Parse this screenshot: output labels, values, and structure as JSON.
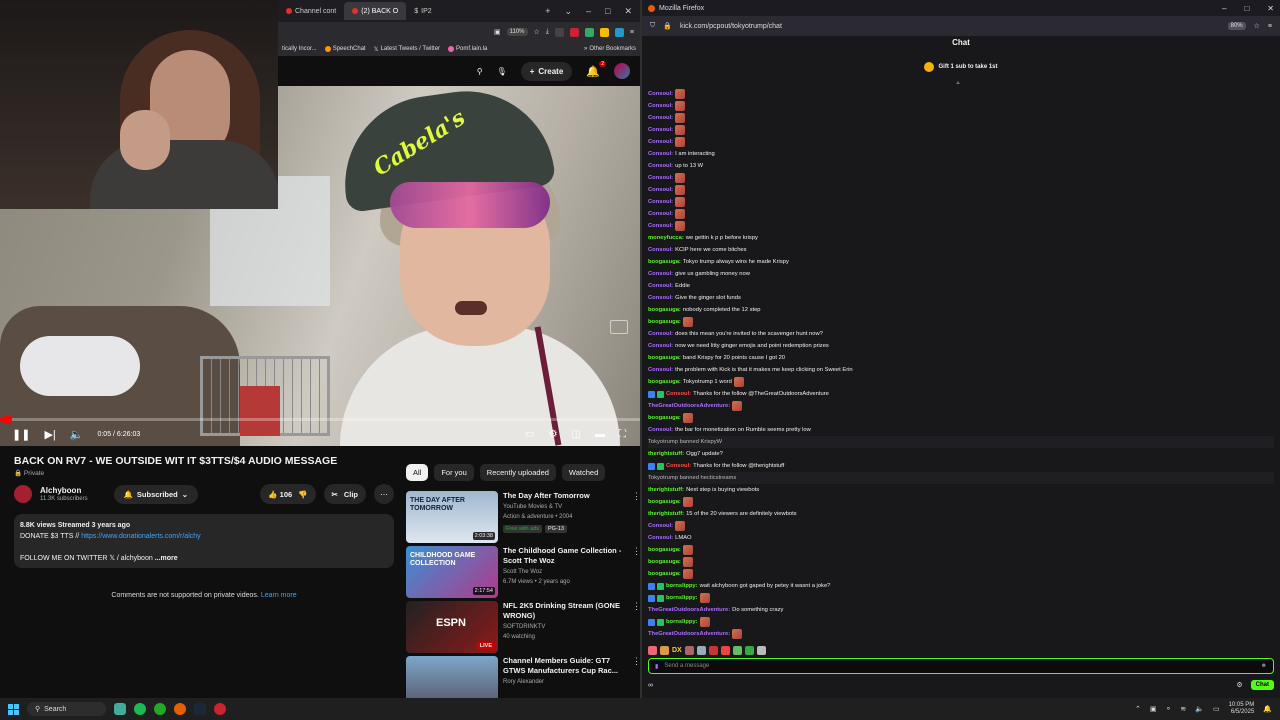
{
  "left_browser": {
    "tabs": [
      {
        "label": "Channel cont",
        "active": false
      },
      {
        "label": "(2) BACK O",
        "active": true
      },
      {
        "label": "IP2",
        "active": false
      }
    ],
    "zoom": "110%",
    "bookmarks": [
      "tically Incor...",
      "SpeechChat",
      "Latest Tweets / Twitter",
      "Pomf.lain.la"
    ],
    "other_bookmarks": "Other Bookmarks"
  },
  "youtube": {
    "create_label": "Create",
    "notif_count": "2",
    "player": {
      "time": "0:05 / 6:26:03",
      "progress_fraction": 0.01
    },
    "video_title": "BACK ON RV7 - WE OUTSIDE WIT IT $3TTS/$4 AUDIO MESSAGE",
    "privacy": "Private",
    "channel": {
      "name": "Alchyboon",
      "subs": "11.3K subscribers"
    },
    "subscribed_label": "Subscribed",
    "likes": "106",
    "clip_label": "Clip",
    "description": {
      "meta": "8.8K views  Streamed 3 years ago",
      "donate_prefix": "DONATE $3 TTS // ",
      "donate_link": "https://www.donationalerts.com/r/alchy",
      "twitter": "FOLLOW ME ON TWITTER",
      "twitter_handle": "/ alchyboon",
      "more": "...more"
    },
    "comments_note": "Comments are not supported on private videos.",
    "learn_more": "Learn more",
    "chips": [
      "All",
      "For you",
      "Recently uploaded",
      "Watched"
    ],
    "recommendations": [
      {
        "title": "The Day After Tomorrow",
        "meta1": "YouTube Movies & TV",
        "meta2": "Action & adventure • 2004",
        "tag1": "Free with ads",
        "tag2": "PG-13",
        "duration": "2:03:38",
        "thumb_text": "THE DAY AFTER TOMORROW"
      },
      {
        "title": "The Childhood Game Collection - Scott The Woz",
        "meta1": "Scott The Woz",
        "meta2": "6.7M views • 2 years ago",
        "duration": "2:17:54",
        "thumb_text": "CHILDHOOD GAME COLLECTION"
      },
      {
        "title": "NFL 2K5 Drinking Stream (GONE WRONG)",
        "meta1": "SOFTDRINKTV",
        "meta2": "40 watching",
        "live": "LIVE",
        "thumb_text": "ESPN"
      },
      {
        "title": "Channel Members Guide: GT7 GTWS Manufacturers Cup Rac...",
        "meta1": "Rory Alexander",
        "meta2": "",
        "thumb_text": ""
      }
    ]
  },
  "firefox": {
    "window_title": "Mozilla Firefox",
    "url": "kick.com/pcpout/tokyotrump/chat",
    "zoom": "80%"
  },
  "chat": {
    "header": "Chat",
    "pinned": "Gift 1 sub to take 1st",
    "messages": [
      {
        "user": "Consoul:",
        "text": "",
        "emote": true,
        "color": "#a970ff"
      },
      {
        "user": "Consoul:",
        "text": "",
        "emote": true,
        "color": "#a970ff"
      },
      {
        "user": "Consoul:",
        "text": "",
        "emote": true,
        "color": "#a970ff"
      },
      {
        "user": "Consoul:",
        "text": "",
        "emote": true,
        "color": "#a970ff"
      },
      {
        "user": "Consoul:",
        "text": "",
        "emote": true,
        "color": "#a970ff"
      },
      {
        "user": "Consoul:",
        "text": "I am interacting",
        "color": "#a970ff"
      },
      {
        "user": "Consoul:",
        "text": "up to 13 W",
        "color": "#a970ff"
      },
      {
        "user": "Consoul:",
        "text": "",
        "emote": true,
        "color": "#a970ff"
      },
      {
        "user": "Consoul:",
        "text": "",
        "emote": true,
        "color": "#a970ff"
      },
      {
        "user": "Consoul:",
        "text": "",
        "emote": true,
        "color": "#a970ff"
      },
      {
        "user": "Consoul:",
        "text": "",
        "emote": true,
        "color": "#a970ff"
      },
      {
        "user": "Consoul:",
        "text": "",
        "emote": true,
        "color": "#a970ff"
      },
      {
        "user": "moneyfucca:",
        "text": "we gettin k p p before krispy",
        "color": "#53fc18"
      },
      {
        "user": "Consoul:",
        "text": "KCIP here we come bitches",
        "color": "#a970ff"
      },
      {
        "user": "boogasuga:",
        "text": "Tokyo trump always wins he made Krispy",
        "color": "#53fc18"
      },
      {
        "user": "Consoul:",
        "text": "give us gambling money now",
        "color": "#a970ff"
      },
      {
        "user": "Consoul:",
        "text": "Eddie",
        "color": "#a970ff"
      },
      {
        "user": "Consoul:",
        "text": "Give the ginger slot funds",
        "color": "#a970ff"
      },
      {
        "user": "boogasuga:",
        "text": "nobody completed the 12 step",
        "color": "#53fc18"
      },
      {
        "user": "boogasuga:",
        "text": "",
        "emote": true,
        "color": "#53fc18"
      },
      {
        "user": "Consoul:",
        "text": "does this mean you're invited to the scavenger hunt now?",
        "color": "#a970ff"
      },
      {
        "user": "Consoul:",
        "text": "now we need litty ginger emojis and point redemption prizes",
        "color": "#a970ff"
      },
      {
        "user": "boogasuga:",
        "text": "band Krispy for 20 points cause I got 20",
        "color": "#53fc18"
      },
      {
        "user": "Consoul:",
        "text": "the problem with Kick is that it makes me keep clicking on Sweet Erin",
        "color": "#a970ff"
      },
      {
        "user": "boogasuga:",
        "text": "Tokyotrump 1 word",
        "emote": true,
        "color": "#53fc18"
      },
      {
        "user": "Consoul:",
        "text": "Thanks for the follow @TheGreatOutdoorsAdventure",
        "badges": true,
        "color": "#ff4d4d"
      },
      {
        "user": "TheGreatOutdoorsAdventure:",
        "text": "",
        "emote": true,
        "color": "#a970ff"
      },
      {
        "user": "boogasuga:",
        "text": "",
        "emote": true,
        "color": "#53fc18"
      },
      {
        "user": "Consoul:",
        "text": "the bar for monetization on Rumble seems pretty low",
        "color": "#a970ff"
      },
      {
        "sys": true,
        "text": "Tokyotrump banned KrispyW"
      },
      {
        "user": "therightstuff:",
        "text": "Ogg7 update?",
        "color": "#53fc18"
      },
      {
        "user": "Consoul:",
        "text": "Thanks for the follow @therightstuff",
        "badges": true,
        "color": "#ff4d4d"
      },
      {
        "sys": true,
        "text": "Tokyotrump banned hecticstreams"
      },
      {
        "user": "therightstuff:",
        "text": "Next step is buying viewbots",
        "color": "#53fc18"
      },
      {
        "user": "boogasuga:",
        "text": "",
        "emote": true,
        "color": "#53fc18"
      },
      {
        "user": "therightstuff:",
        "text": "15 of the 20 viewers are definitely viewbots",
        "color": "#53fc18"
      },
      {
        "user": "Consoul:",
        "text": "",
        "emote": true,
        "color": "#a970ff"
      },
      {
        "user": "Consoul:",
        "text": "LMAO",
        "color": "#a970ff"
      },
      {
        "user": "boogasuga:",
        "text": "",
        "emote": true,
        "color": "#53fc18"
      },
      {
        "user": "boogasuga:",
        "text": "",
        "emote": true,
        "color": "#53fc18"
      },
      {
        "user": "boogasuga:",
        "text": "",
        "emote": true,
        "color": "#53fc18"
      },
      {
        "user": "bornslippy:",
        "text": "wait alchyboon got gaped by petey it wasnt a joke?",
        "badges": true,
        "color": "#53fc18"
      },
      {
        "user": "bornslippy:",
        "text": "",
        "emote": true,
        "badges": true,
        "color": "#53fc18"
      },
      {
        "user": "TheGreatOutdoorsAdventure:",
        "text": "Do something crazy",
        "color": "#a970ff"
      },
      {
        "user": "bornslippy:",
        "text": "",
        "emote": true,
        "badges": true,
        "color": "#53fc18"
      },
      {
        "user": "TheGreatOutdoorsAdventure:",
        "text": "",
        "emote": true,
        "color": "#a970ff"
      }
    ],
    "input_placeholder": "Send a message",
    "chat_button": "Chat",
    "footer_left": "∞"
  },
  "taskbar": {
    "search_label": "Search",
    "time": "10:05 PM",
    "date": "6/5/2025"
  }
}
